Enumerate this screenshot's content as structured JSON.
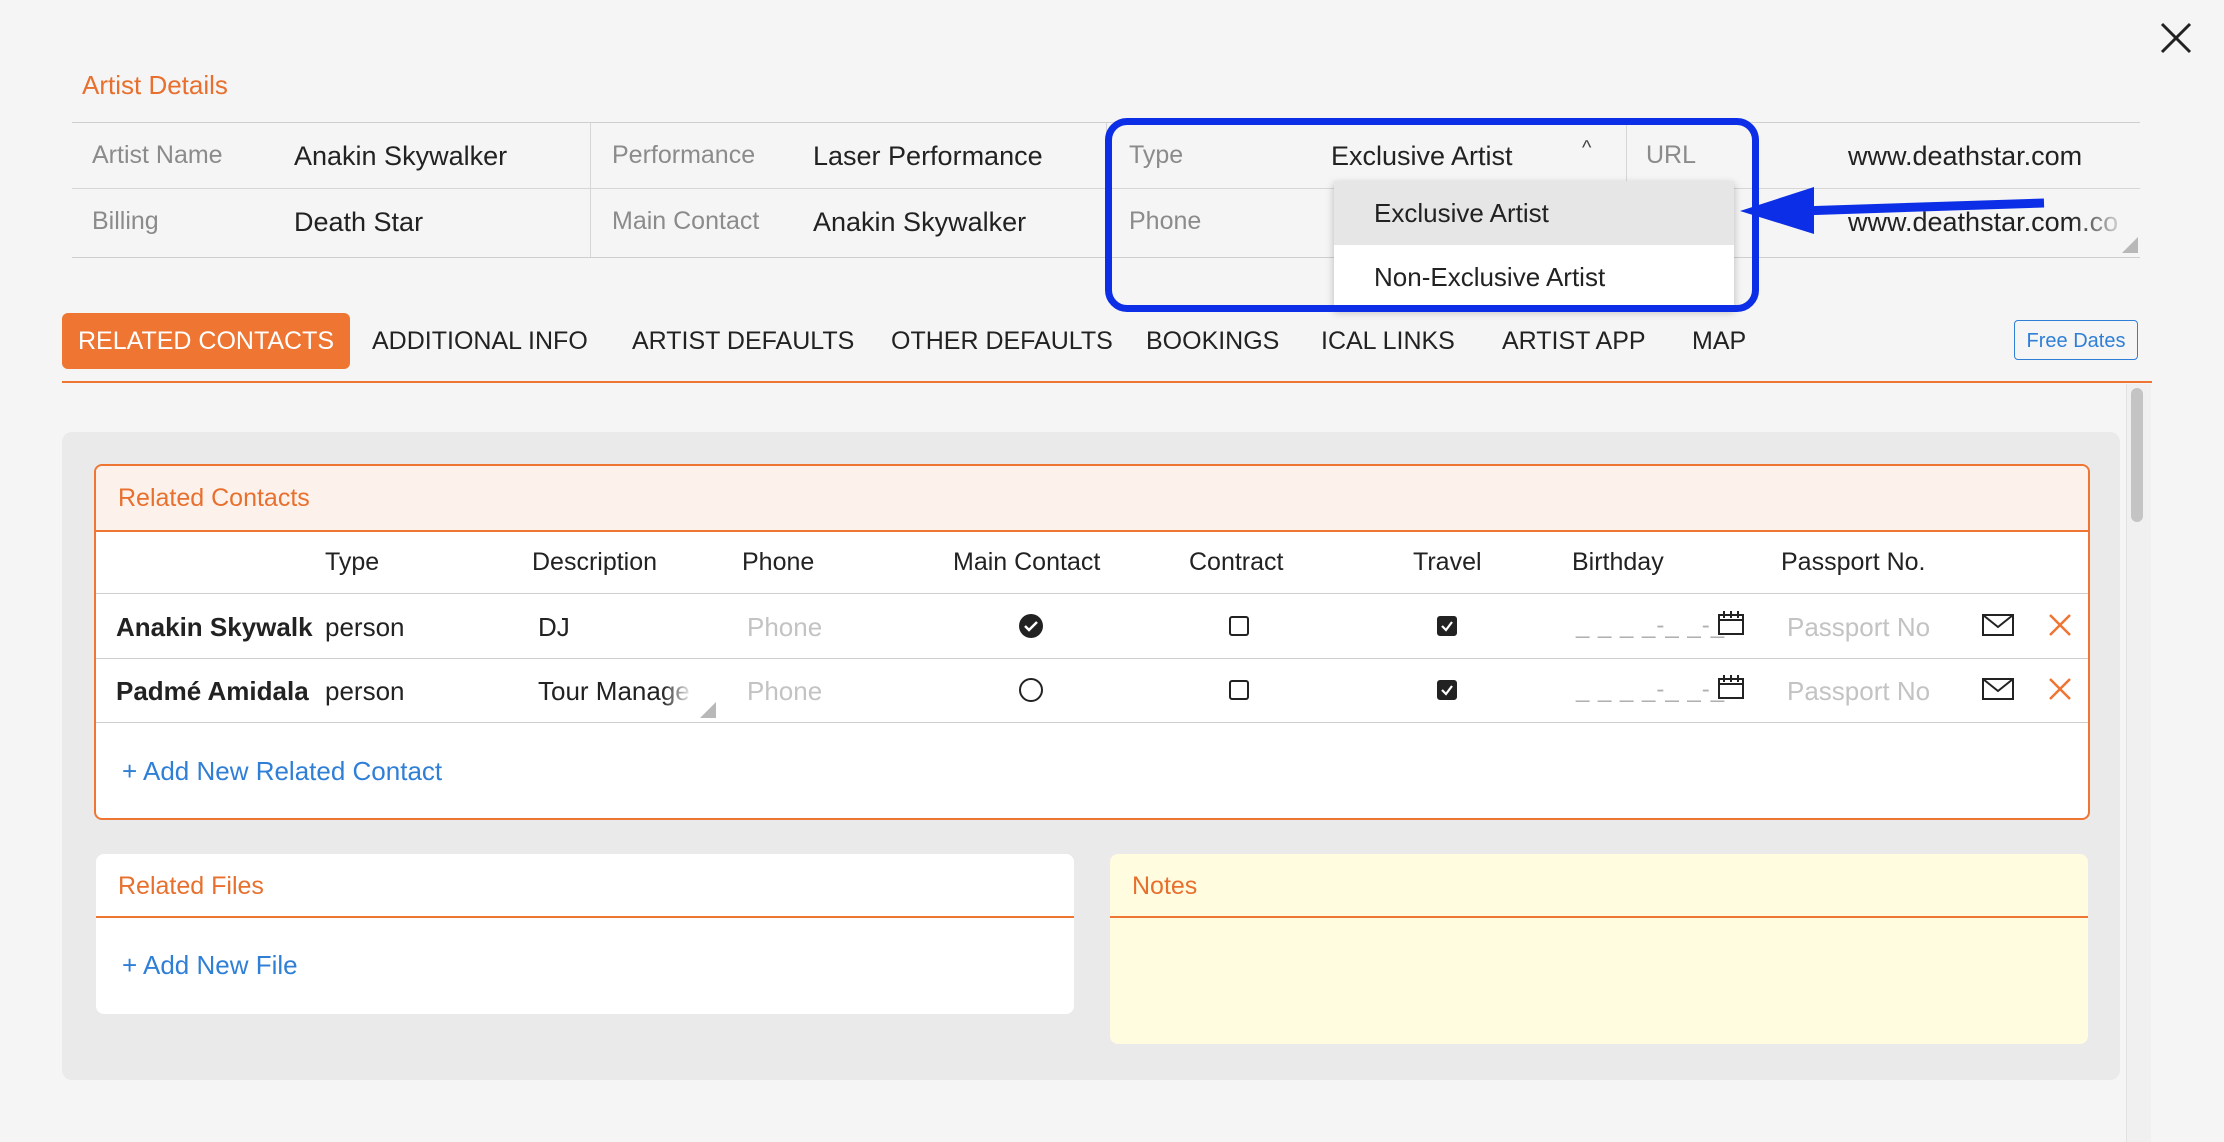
{
  "details": {
    "title": "Artist Details",
    "fields": {
      "artist_name": {
        "label": "Artist Name",
        "value": "Anakin Skywalker"
      },
      "performance": {
        "label": "Performance",
        "value": "Laser Performance"
      },
      "type": {
        "label": "Type",
        "value": "Exclusive Artist"
      },
      "url": {
        "label": "URL",
        "value": "www.deathstar.com"
      },
      "billing": {
        "label": "Billing",
        "value": "Death Star"
      },
      "main_contact": {
        "label": "Main Contact",
        "value": "Anakin Skywalker"
      },
      "phone": {
        "label": "Phone",
        "value": ""
      },
      "url2": {
        "value": "www.deathstar.com.co"
      }
    }
  },
  "type_dropdown": {
    "options": [
      "Exclusive Artist",
      "Non-Exclusive Artist"
    ],
    "selected": "Exclusive Artist"
  },
  "tabs": {
    "items": [
      "RELATED CONTACTS",
      "ADDITIONAL INFO",
      "ARTIST DEFAULTS",
      "OTHER DEFAULTS",
      "BOOKINGS",
      "ICAL LINKS",
      "ARTIST APP",
      "MAP"
    ],
    "active": "RELATED CONTACTS",
    "free_dates": "Free Dates"
  },
  "related_contacts": {
    "title": "Related Contacts",
    "columns": [
      "Type",
      "Description",
      "Phone",
      "Main Contact",
      "Contract",
      "Travel",
      "Birthday",
      "Passport No."
    ],
    "rows": [
      {
        "name": "Anakin Skywalk",
        "type": "person",
        "description": "DJ",
        "phone_placeholder": "Phone",
        "main_contact": true,
        "contract": false,
        "travel": true,
        "birthday_placeholder": "_ _ _ _-_ _-_",
        "passport_placeholder": "Passport No"
      },
      {
        "name": "Padmé Amidala",
        "type": "person",
        "description": "Tour Manage",
        "phone_placeholder": "Phone",
        "main_contact": false,
        "contract": false,
        "travel": true,
        "birthday_placeholder": "_ _ _ _-_ _-_",
        "passport_placeholder": "Passport No"
      }
    ],
    "add_label": "+ Add New Related Contact"
  },
  "related_files": {
    "title": "Related Files",
    "add_label": "+ Add New File"
  },
  "notes": {
    "title": "Notes"
  },
  "colors": {
    "accent": "#ef7533",
    "link": "#2f7fd6",
    "highlight": "#0c2ee6",
    "notes_bg": "#fffce0"
  }
}
